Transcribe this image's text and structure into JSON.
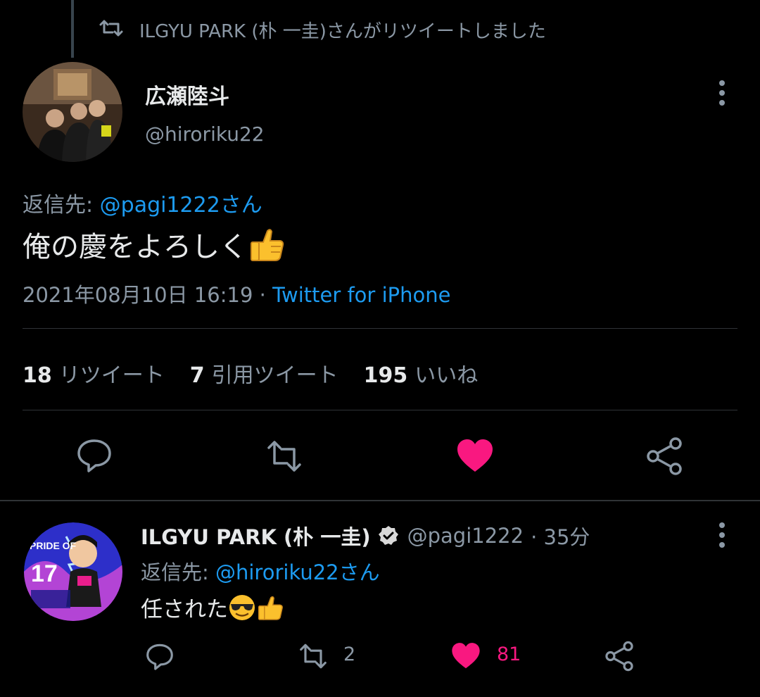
{
  "retweet_header": {
    "text": "ILGYU PARK (朴 一圭)さんがリツイートしました"
  },
  "main_tweet": {
    "author_name": "広瀬陸斗",
    "author_handle": "@hiroriku22",
    "reply_prefix": "返信先: ",
    "reply_target": "@pagi1222さん",
    "body_text": "俺の慶をよろしく",
    "emoji": "thumbs-up",
    "timestamp": "2021年08月10日 16:19 · ",
    "client": "Twitter for iPhone",
    "stats": {
      "retweets_count": "18",
      "retweets_label": "リツイート",
      "quotes_count": "7",
      "quotes_label": "引用ツイート",
      "likes_count": "195",
      "likes_label": "いいね"
    },
    "liked": true
  },
  "reply_tweet": {
    "author_name": "ILGYU PARK (朴 一圭)",
    "author_handle": "@pagi1222",
    "time": "· 35分",
    "verified": true,
    "reply_prefix": "返信先: ",
    "reply_target": "@hiroriku22さん",
    "body_text": "任された",
    "emojis": [
      "sunglasses-face",
      "thumbs-up"
    ],
    "retweet_count": "2",
    "like_count": "81",
    "liked": true
  },
  "avatar_texts": {
    "jersey_number": "17",
    "pride_of": "PRIDE OF"
  },
  "colors": {
    "background": "#000000",
    "text_primary": "#e7e9ea",
    "text_secondary": "#8b98a5",
    "link": "#1d9bf0",
    "like": "#f91880",
    "divider": "#2f3336"
  }
}
